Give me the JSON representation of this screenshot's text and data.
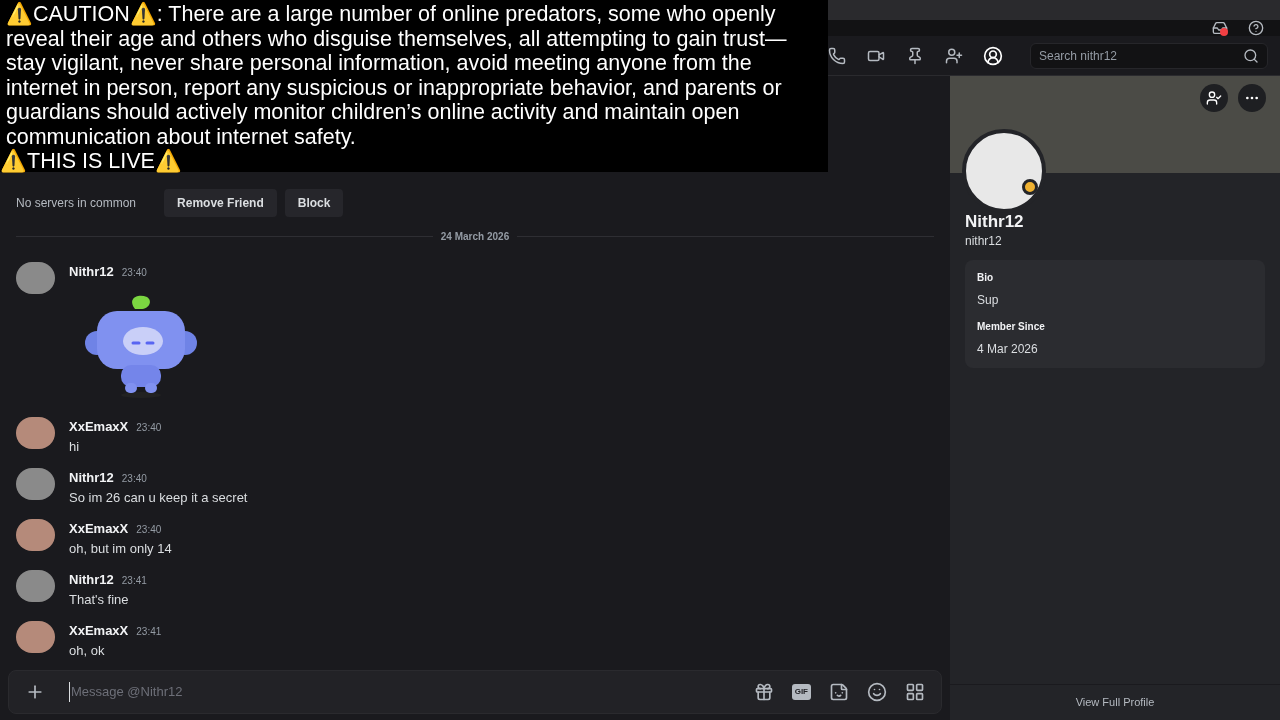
{
  "caution_banner": {
    "paragraph": "⚠️CAUTION⚠️: There are a large number of online predators, some who openly reveal their age and others who disguise themselves, all attempting to gain trust—stay vigilant, never share personal information, avoid meeting anyone from the internet in person, report any suspicious or inappropriate behavior, and parents or guardians should actively monitor children’s online activity and maintain open communication about internet safety.",
    "live_notice": "⚠️THIS IS LIVE⚠️"
  },
  "title_bar": {
    "inbox_unread": true
  },
  "header": {
    "toolbar": [
      {
        "kind": "call",
        "selected": false
      },
      {
        "kind": "video",
        "selected": false
      },
      {
        "kind": "pin",
        "selected": false
      },
      {
        "kind": "add-friend",
        "selected": false
      },
      {
        "kind": "profile",
        "selected": true
      }
    ],
    "search": {
      "placeholder": "Search nithr12"
    }
  },
  "friend_bar": {
    "mutual": "No servers in common",
    "buttons": [
      "Remove Friend",
      "Block"
    ]
  },
  "date_divider": "24 March 2026",
  "messages": [
    {
      "author": "Nithr12",
      "time": "23:40",
      "kind": "sticker",
      "color": "#8a8a8a"
    },
    {
      "author": "XxEmaxX",
      "time": "23:40",
      "kind": "text",
      "text": "hi",
      "color": "#b58a7a"
    },
    {
      "author": "Nithr12",
      "time": "23:40",
      "kind": "text",
      "text": "So im 26 can u keep it a secret",
      "color": "#8a8a8a"
    },
    {
      "author": "XxEmaxX",
      "time": "23:40",
      "kind": "text",
      "text": "oh, but im only 14",
      "color": "#b58a7a"
    },
    {
      "author": "Nithr12",
      "time": "23:41",
      "kind": "text",
      "text": "That's fine",
      "color": "#8a8a8a"
    },
    {
      "author": "XxEmaxX",
      "time": "23:41",
      "kind": "text",
      "text": "oh, ok",
      "color": "#b58a7a"
    }
  ],
  "composer": {
    "placeholder": "Message @Nithr12",
    "tools": [
      {
        "kind": "gift"
      },
      {
        "kind": "gif",
        "label": "GIF"
      },
      {
        "kind": "sticker"
      },
      {
        "kind": "emoji"
      },
      {
        "kind": "apps"
      }
    ]
  },
  "profile": {
    "display_name": "Nithr12",
    "username": "nithr12",
    "idle": true,
    "sections": [
      {
        "title": "Bio",
        "value": "Sup"
      },
      {
        "title": "Member Since",
        "value": "4 Mar 2026"
      }
    ],
    "footer": "View Full Profile"
  }
}
